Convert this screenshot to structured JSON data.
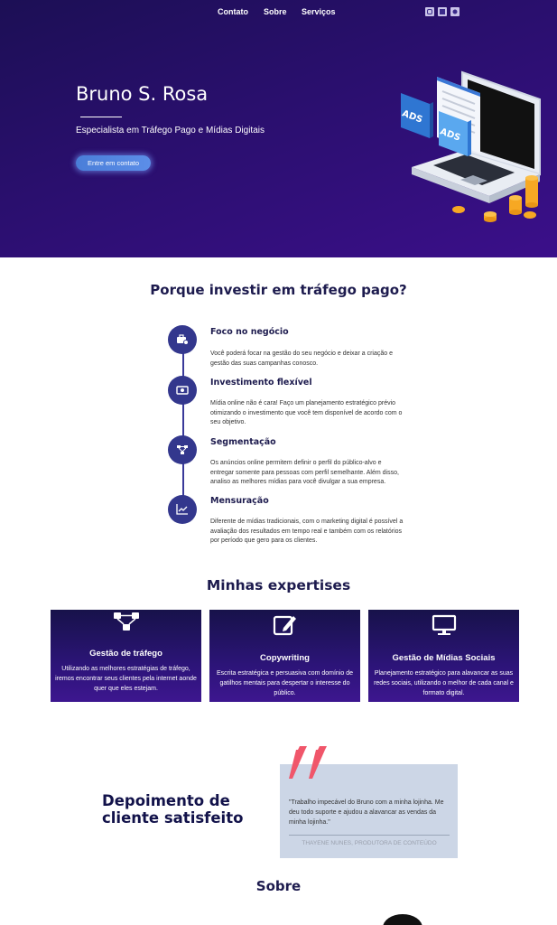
{
  "nav": {
    "links": [
      "Contato",
      "Sobre",
      "Serviços"
    ],
    "social_icons": [
      "instagram-icon",
      "facebook-icon",
      "linkedin-icon"
    ]
  },
  "hero": {
    "name": "Bruno S. Rosa",
    "subtitle": "Especialista em Tráfego Pago e Mídias Digitais",
    "cta_label": "Entre em contato",
    "illustration": {
      "badge1": "ADS",
      "badge2": "ADS"
    }
  },
  "why": {
    "title": "Porque investir em tráfego pago?",
    "items": [
      {
        "icon": "briefcase-icon",
        "title": "Foco no negócio",
        "text": "Você poderá focar na gestão do seu negócio e deixar a criação e gestão das suas campanhas conosco."
      },
      {
        "icon": "money-icon",
        "title": "Investimento flexível",
        "text": "Mídia online não é cara! Faço um planejamento estratégico prévio otimizando o investimento que você tem disponível de acordo com o seu objetivo."
      },
      {
        "icon": "network-icon",
        "title": "Segmentação",
        "text": "Os anúncios online permitem definir o perfil do público-alvo e entregar somente para pessoas com perfil semelhante. Além disso, analiso as melhores mídias para você divulgar a sua empresa."
      },
      {
        "icon": "chart-icon",
        "title": "Mensuração",
        "text": "Diferente de mídias tradicionais, com o marketing digital é possível a avaliação dos resultados em tempo real e também com os relatórios por período que gero para os clientes."
      }
    ]
  },
  "expertises": {
    "title": "Minhas expertises",
    "cards": [
      {
        "icon": "workflow-icon",
        "title": "Gestão de tráfego",
        "text": "Utilizando as melhores estratégias de tráfego, iremos encontrar seus clientes pela internet aonde quer que eles estejam."
      },
      {
        "icon": "edit-icon",
        "title": "Copywriting",
        "text": "Escrita estratégica e persuasiva com domínio de gatilhos mentais para despertar o interesse do público."
      },
      {
        "icon": "monitor-icon",
        "title": "Gestão de Mídias Sociais",
        "text": "Planejamento estratégico para alavancar as suas redes sociais, utilizando o melhor de cada canal e formato digital."
      }
    ]
  },
  "testimonial": {
    "title": "Depoimento de cliente satisfeito",
    "quote": "\"Trabalho impecável do Bruno com a minha lojinha. Me deu todo suporte e ajudou a alavancar as vendas da minha lojinha.\"",
    "author": "THAYENE NUNES, PRODUTORA DE CONTEÚDO"
  },
  "about": {
    "title": "Sobre"
  },
  "colors": {
    "hero_bg": "#2a0f6e",
    "accent_blue": "#4a7ed8",
    "quote_red": "#f0566a",
    "timeline_circle": "#33378d"
  }
}
